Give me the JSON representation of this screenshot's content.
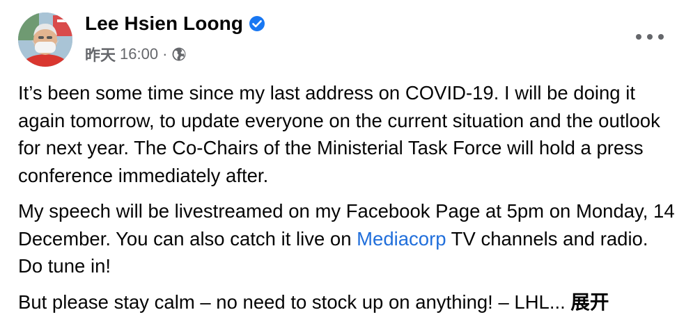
{
  "post": {
    "author": "Lee Hsien Loong",
    "date": "昨天",
    "time": "16:00",
    "separator": "·",
    "audience_icon": "globe-icon",
    "verified_icon": "verified-badge-icon",
    "more_icon": "more-options-icon",
    "paragraphs": {
      "p1": "It’s been some time since my last address on COVID-19. I will be doing it again tomorrow, to update everyone on the current situation and the outlook for next year. The Co-Chairs of the Ministerial Task Force will hold a press conference immediately after.",
      "p2_before": "My speech will be livestreamed on my Facebook Page at 5pm on Monday, 14 December. You can also catch it live on ",
      "p2_link": "Mediacorp",
      "p2_after": " TV channels and radio. Do tune in!",
      "p3": "But please stay calm – no need to stock up on anything! – LHL...",
      "see_more": "展开"
    },
    "colors": {
      "text": "#050505",
      "secondary": "#65676b",
      "link": "#216fdb",
      "verified": "#1877f2"
    }
  }
}
